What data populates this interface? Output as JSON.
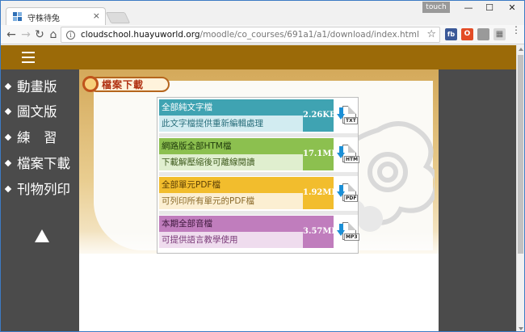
{
  "browser": {
    "tab_title": "守株待兔",
    "tab_close": "×",
    "touch_label": "touch",
    "window_controls": {
      "minimize": "—",
      "maximize": "☐",
      "close": "✕"
    },
    "url_host": "cloudschool.huayuworld.org",
    "url_path": "/moodle/co_courses/691a1/a1/download/index.html",
    "nav": {
      "back": "←",
      "forward": "→",
      "reload": "↻",
      "home": "⌂"
    },
    "star": "☆",
    "info": "i",
    "menu": "⋮",
    "extensions": [
      {
        "name": "fb-extension-icon",
        "label": "fb",
        "color": "#3b5998"
      },
      {
        "name": "office-extension-icon",
        "label": "O",
        "color": "#e34c26"
      },
      {
        "name": "gray-extension-icon",
        "label": "",
        "color": "#9a9a9a"
      },
      {
        "name": "grid-extension-icon",
        "label": "▦",
        "color": "#b0b0b0"
      },
      {
        "name": "chrome-extension-icon",
        "label": "",
        "color": "#3c8b3c"
      }
    ]
  },
  "site": {
    "menu_icon": "hamburger-icon",
    "nav_items": [
      {
        "label": "動畫版"
      },
      {
        "label": "圖文版"
      },
      {
        "label": "練　習"
      },
      {
        "label": "檔案下載"
      },
      {
        "label": "刊物列印"
      }
    ],
    "nav_up_icon": "up-triangle-icon",
    "section_title": "檔案下載",
    "colors": {
      "topbar": "#9b6a08",
      "sidebar": "#4b4b4b"
    }
  },
  "downloads": [
    {
      "title": "全部純文字檔",
      "description": "此文字檔提供重新編輯處理",
      "size": "2.26KB",
      "tag": "TXT",
      "title_bg": "#3fa3b2",
      "desc_bg": "#d2ecf1",
      "desc_color": "#2a6f7c",
      "size_bg": "#3fa3b2"
    },
    {
      "title": "網路版全部HTM檔",
      "description": "下載解壓縮後可離線閱讀",
      "size": "17.1MB",
      "tag": "HTM",
      "title_bg": "#8cc04f",
      "desc_bg": "#e0efcf",
      "desc_color": "#3d5a1c",
      "size_bg": "#8cc04f"
    },
    {
      "title": "全部單元PDF檔",
      "description": "可列印所有單元的PDF檔",
      "size": "1.92MB",
      "tag": "PDF",
      "title_bg": "#f2bd2d",
      "desc_bg": "#fcefd2",
      "desc_color": "#8a6a2a",
      "size_bg": "#f2bd2d"
    },
    {
      "title": "本期全部音檔",
      "description": "可提供語言教學使用",
      "size": "3.57MB",
      "tag": "MP3",
      "title_bg": "#c07dbd",
      "desc_bg": "#efdcee",
      "desc_color": "#7a3a78",
      "size_bg": "#c07dbd"
    }
  ]
}
